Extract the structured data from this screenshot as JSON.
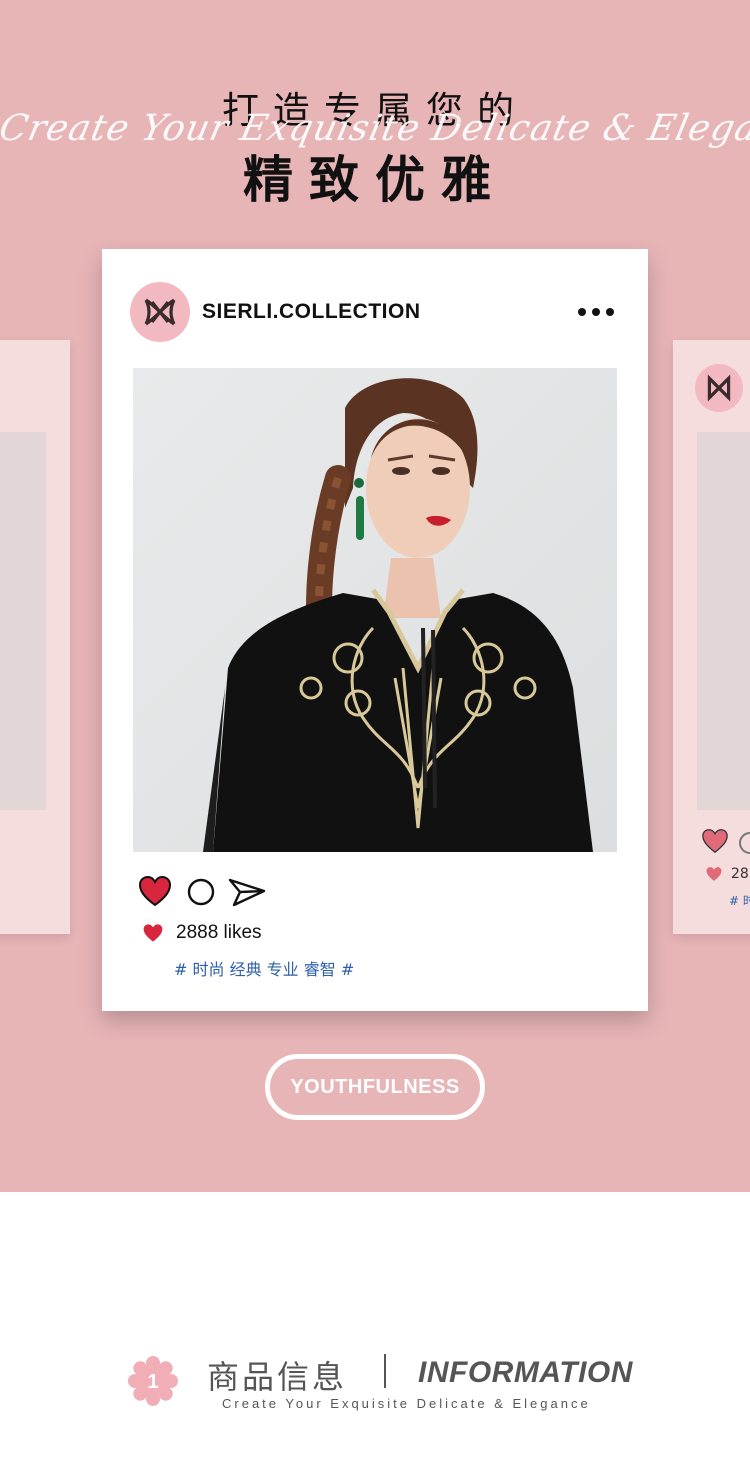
{
  "hero": {
    "title_top": "打造专属您的",
    "script_text": "Create Your Exquisite Delicate & Elegance",
    "title_main": "精致优雅",
    "background_color": "#e8b5b7"
  },
  "post": {
    "username": "SIERLI.COLLECTION",
    "likes_text": "2888 likes",
    "tags": "# 时尚 经典 专业 睿智 #",
    "liked": true,
    "icons": [
      "more-icon",
      "heart-icon",
      "comment-icon",
      "send-icon"
    ]
  },
  "side_card": {
    "likes_text": "28",
    "tag_text": "# 时"
  },
  "pill": {
    "label": "YOUTHFULNESS"
  },
  "info": {
    "number": "1",
    "cn_title": "商品信息",
    "en_title": "INFORMATION",
    "subtitle": "Create Your Exquisite Delicate & Elegance"
  },
  "colors": {
    "pink": "#e8b5b7",
    "heart_red": "#d7263d",
    "tag_blue": "#2e5fa8",
    "text_dark": "#111111",
    "text_gray": "#555555"
  }
}
